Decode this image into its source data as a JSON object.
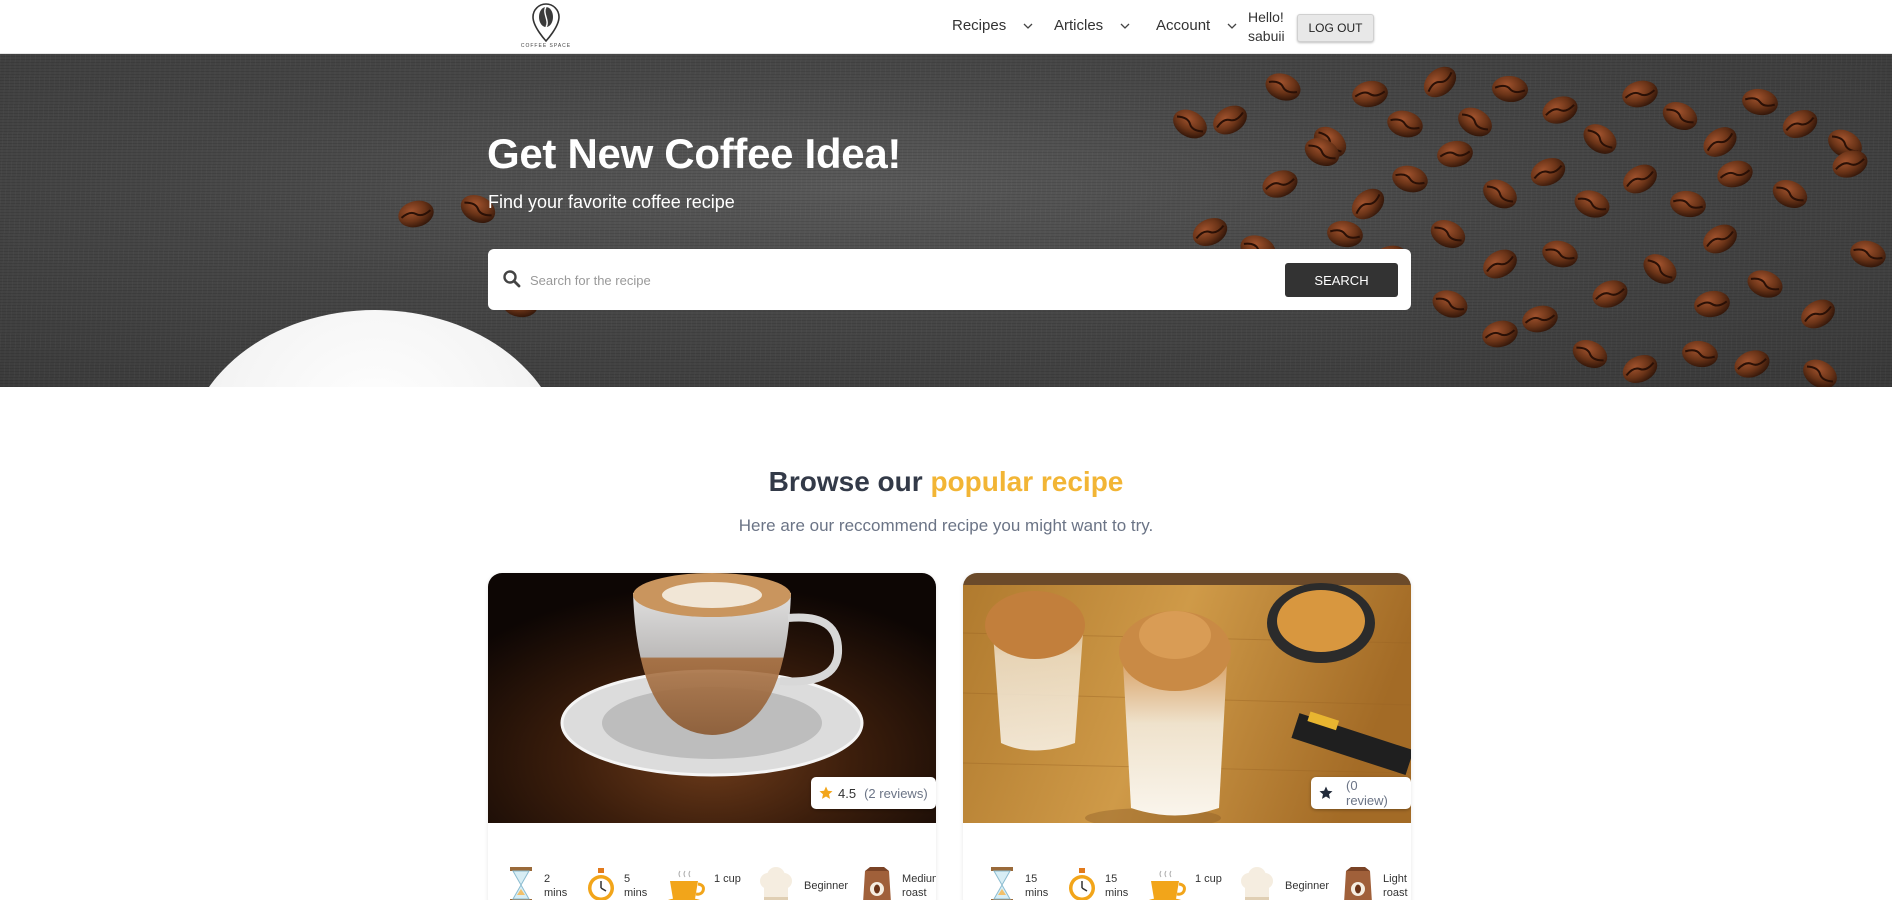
{
  "header": {
    "logo_text": "COFFEE SPACE",
    "nav": [
      {
        "label": "Recipes"
      },
      {
        "label": "Articles"
      },
      {
        "label": "Account"
      }
    ],
    "greeting": "Hello!",
    "username": "sabuii",
    "logout_label": "LOG OUT"
  },
  "hero": {
    "title": "Get New Coffee Idea!",
    "subtitle": "Find your favorite coffee recipe",
    "search": {
      "placeholder": "Search for the recipe",
      "value": "",
      "button_label": "SEARCH"
    }
  },
  "section": {
    "title_prefix": "Browse our",
    "title_accent": "popular recipe",
    "subtitle": "Here are our reccommend recipe you might want to try."
  },
  "cards": [
    {
      "rating": "4.5",
      "reviews": "(2 reviews)",
      "prep_time": "2 mins",
      "brew_time": "5 mins",
      "serving": "1 cup",
      "level": "Beginner",
      "roast": "Medium roast"
    },
    {
      "rating": "",
      "reviews": "(0 review)",
      "prep_time": "15 mins",
      "brew_time": "15 mins",
      "serving": "1 cup",
      "level": "Beginner",
      "roast": "Light roast"
    }
  ],
  "colors": {
    "accent": "#f2b535",
    "dark_button": "#333333",
    "heading": "#333a48",
    "muted": "#6b7486"
  },
  "icons": [
    "coffee-bean-logo-icon",
    "chevron-down-icon",
    "search-icon",
    "star-icon",
    "hourglass-icon",
    "stopwatch-icon",
    "coffee-cup-icon",
    "chef-hat-icon",
    "coffee-bag-icon"
  ]
}
